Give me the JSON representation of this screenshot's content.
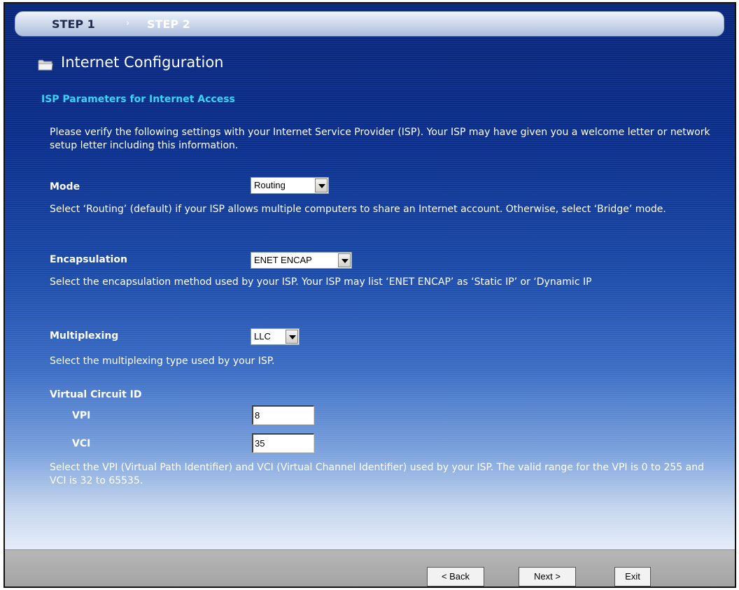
{
  "steps": {
    "step1": "STEP 1",
    "separator": "›",
    "step2": "STEP 2"
  },
  "header": {
    "icon": "folder-icon",
    "title": "Internet Configuration"
  },
  "section": {
    "title": "ISP Parameters for Internet Access",
    "intro": "Please verify the following settings with your Internet Service Provider (ISP). Your ISP may have given you a welcome letter or network setup letter including this information."
  },
  "mode": {
    "label": "Mode",
    "value": "Routing",
    "help": "Select ‘Routing’ (default) if your ISP allows multiple computers to share an Internet account. Otherwise, select ‘Bridge’ mode."
  },
  "encapsulation": {
    "label": "Encapsulation",
    "value": "ENET ENCAP",
    "help": "Select the encapsulation method used by your ISP. Your ISP may list ‘ENET ENCAP’ as ‘Static IP’ or ‘Dynamic IP"
  },
  "multiplexing": {
    "label": "Multiplexing",
    "value": "LLC",
    "help": "Select the multiplexing type used by your ISP."
  },
  "virtual_circuit": {
    "label": "Virtual Circuit ID",
    "vpi_label": "VPI",
    "vpi_value": "8",
    "vci_label": "VCI",
    "vci_value": "35",
    "help": "Select the VPI (Virtual Path Identifier) and VCI (Virtual Channel Identifier) used by your ISP. The valid range for the VPI is 0 to 255 and VCI is 32 to 65535."
  },
  "buttons": {
    "back": "< Back",
    "next": "Next >",
    "exit": "Exit"
  }
}
